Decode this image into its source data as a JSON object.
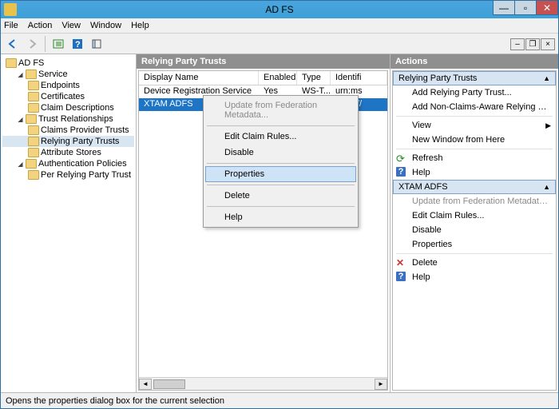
{
  "title": "AD FS",
  "menu": {
    "file": "File",
    "action": "Action",
    "view": "View",
    "window": "Window",
    "help": "Help"
  },
  "nav": {
    "root": "AD FS",
    "service": "Service",
    "endpoints": "Endpoints",
    "certificates": "Certificates",
    "claimdesc": "Claim Descriptions",
    "trustrel": "Trust Relationships",
    "cpt": "Claims Provider Trusts",
    "rpt": "Relying Party Trusts",
    "attrstores": "Attribute Stores",
    "authpol": "Authentication Policies",
    "perrpt": "Per Relying Party Trust"
  },
  "center": {
    "header": "Relying Party Trusts",
    "cols": {
      "dn": "Display Name",
      "en": "Enabled",
      "tp": "Type",
      "id": "Identifi"
    },
    "rows": [
      {
        "dn": "Device Registration Service",
        "en": "Yes",
        "tp": "WS-T...",
        "id": "urn:ms"
      },
      {
        "dn": "XTAM ADFS",
        "en": "",
        "tp": "",
        "id": "https://"
      }
    ]
  },
  "ctx": {
    "update": "Update from Federation Metadata...",
    "editclaim": "Edit Claim Rules...",
    "disable": "Disable",
    "properties": "Properties",
    "delete": "Delete",
    "help": "Help"
  },
  "actions": {
    "title": "Actions",
    "section1": "Relying Party Trusts",
    "addrpt": "Add Relying Party Trust...",
    "addnca": "Add Non-Claims-Aware Relying Party Trus...",
    "view": "View",
    "newwin": "New Window from Here",
    "refresh": "Refresh",
    "help": "Help",
    "section2": "XTAM ADFS",
    "update": "Update from Federation Metadata...",
    "editclaim": "Edit Claim Rules...",
    "disable": "Disable",
    "properties": "Properties",
    "delete": "Delete",
    "help2": "Help"
  },
  "status": "Opens the properties dialog box for the current selection"
}
